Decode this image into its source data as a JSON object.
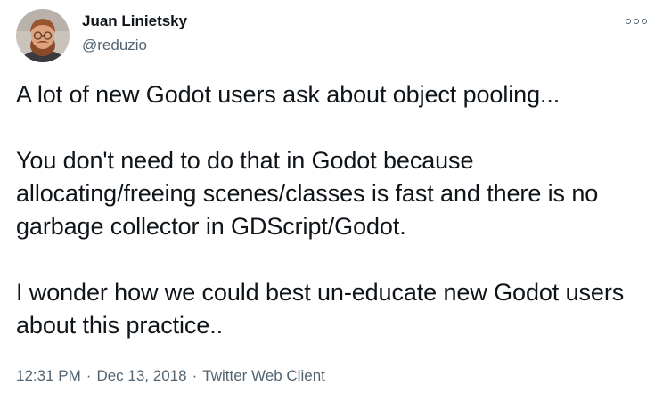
{
  "author": {
    "name": "Juan Linietsky",
    "handle": "@reduzio",
    "avatar_icon": "profile-photo"
  },
  "menu_icon": "more-dots-icon",
  "tweet": {
    "paragraphs": [
      "A lot of new Godot users ask about object pooling...",
      "You don't need to do that in Godot because allocating/freeing scenes/classes is fast and there is no garbage collector in GDScript/Godot.",
      "I wonder how we could best un-educate new Godot users about this practice.."
    ]
  },
  "meta": {
    "time": "12:31 PM",
    "separator": "·",
    "date": "Dec 13, 2018",
    "source": "Twitter Web Client"
  },
  "colors": {
    "text": "#0f1419",
    "secondary": "#536471",
    "background": "#ffffff"
  }
}
